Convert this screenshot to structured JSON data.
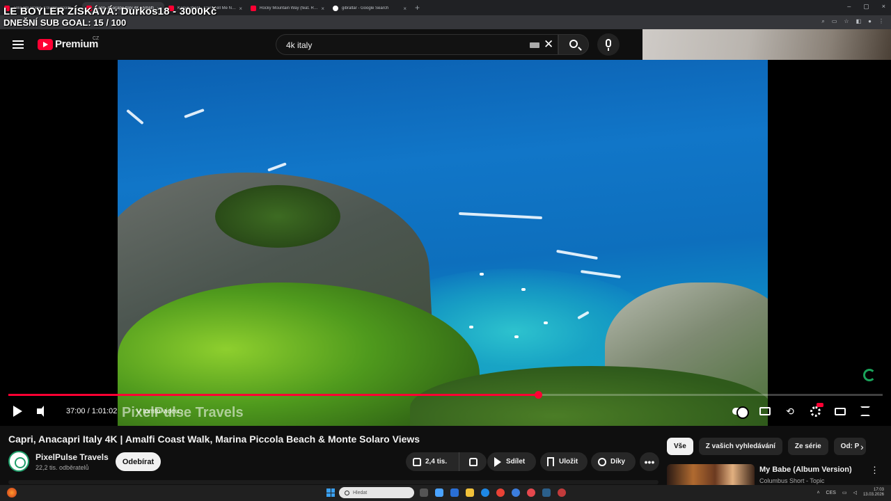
{
  "overlay": {
    "line1": "LE BOYLER ZÍSKÁVÁ: Durkos18 - 3000Kč",
    "line2": "DNEŠNÍ SUB GOAL: 15 / 100"
  },
  "browser": {
    "tabs": [
      {
        "label": "Take Me Home, Country Roads",
        "favicon": "youtube-icon"
      },
      {
        "label": "Capri, Anacapri Italy 4K | Amalfi",
        "favicon": "youtube-icon",
        "active": true
      },
      {
        "label": "Kanye West - Can't Tell Me Noth",
        "favicon": "youtube-icon"
      },
      {
        "label": "Rocky Mountain Way (feat. Rob",
        "favicon": "youtube-icon"
      },
      {
        "label": "gibraltar - Google Search",
        "favicon": "google-icon"
      }
    ],
    "tab_close_glyph": "×",
    "new_tab_glyph": "+",
    "window_controls": [
      "–",
      "▢",
      "×"
    ]
  },
  "header": {
    "brand": "Premium",
    "country_code": "CZ",
    "search_query": "4k italy",
    "clear_glyph": "✕"
  },
  "player": {
    "current_time": "37:00",
    "duration": "1:01:02",
    "time_display": "37:00 / 1:01:02",
    "progress_fraction": 0.606,
    "chapter_label": "V tomto videu ›",
    "watermark": "PixelPulse Travels"
  },
  "video": {
    "title": "Capri, Anacapri Italy 4K | Amalfi Coast Walk, Marina Piccola Beach & Monte Solaro Views",
    "channel": "PixelPulse Travels",
    "subscribers": "22,2 tis. odběratelů",
    "subscribe_label": "Odebírat",
    "likes": "2,4 tis.",
    "share_label": "Sdílet",
    "save_label": "Uložit",
    "thanks_label": "Díky",
    "more_glyph": "•••"
  },
  "sidebar": {
    "chips": [
      "Vše",
      "Z vašich vyhledávání",
      "Ze série",
      "Od: P"
    ],
    "next_glyph": "›",
    "recommendations": [
      {
        "title": "My Babe (Album Version)",
        "channel": "Columbus Short - Topic"
      }
    ],
    "more_glyph": "⋮"
  },
  "taskbar": {
    "search_placeholder": "Hledat",
    "language": "CES",
    "time": "17:03",
    "date": "13.03.2026"
  },
  "colors": {
    "accent": "#ff0033",
    "background": "#0f0f0f",
    "chip_active": "#f1f1f1"
  }
}
